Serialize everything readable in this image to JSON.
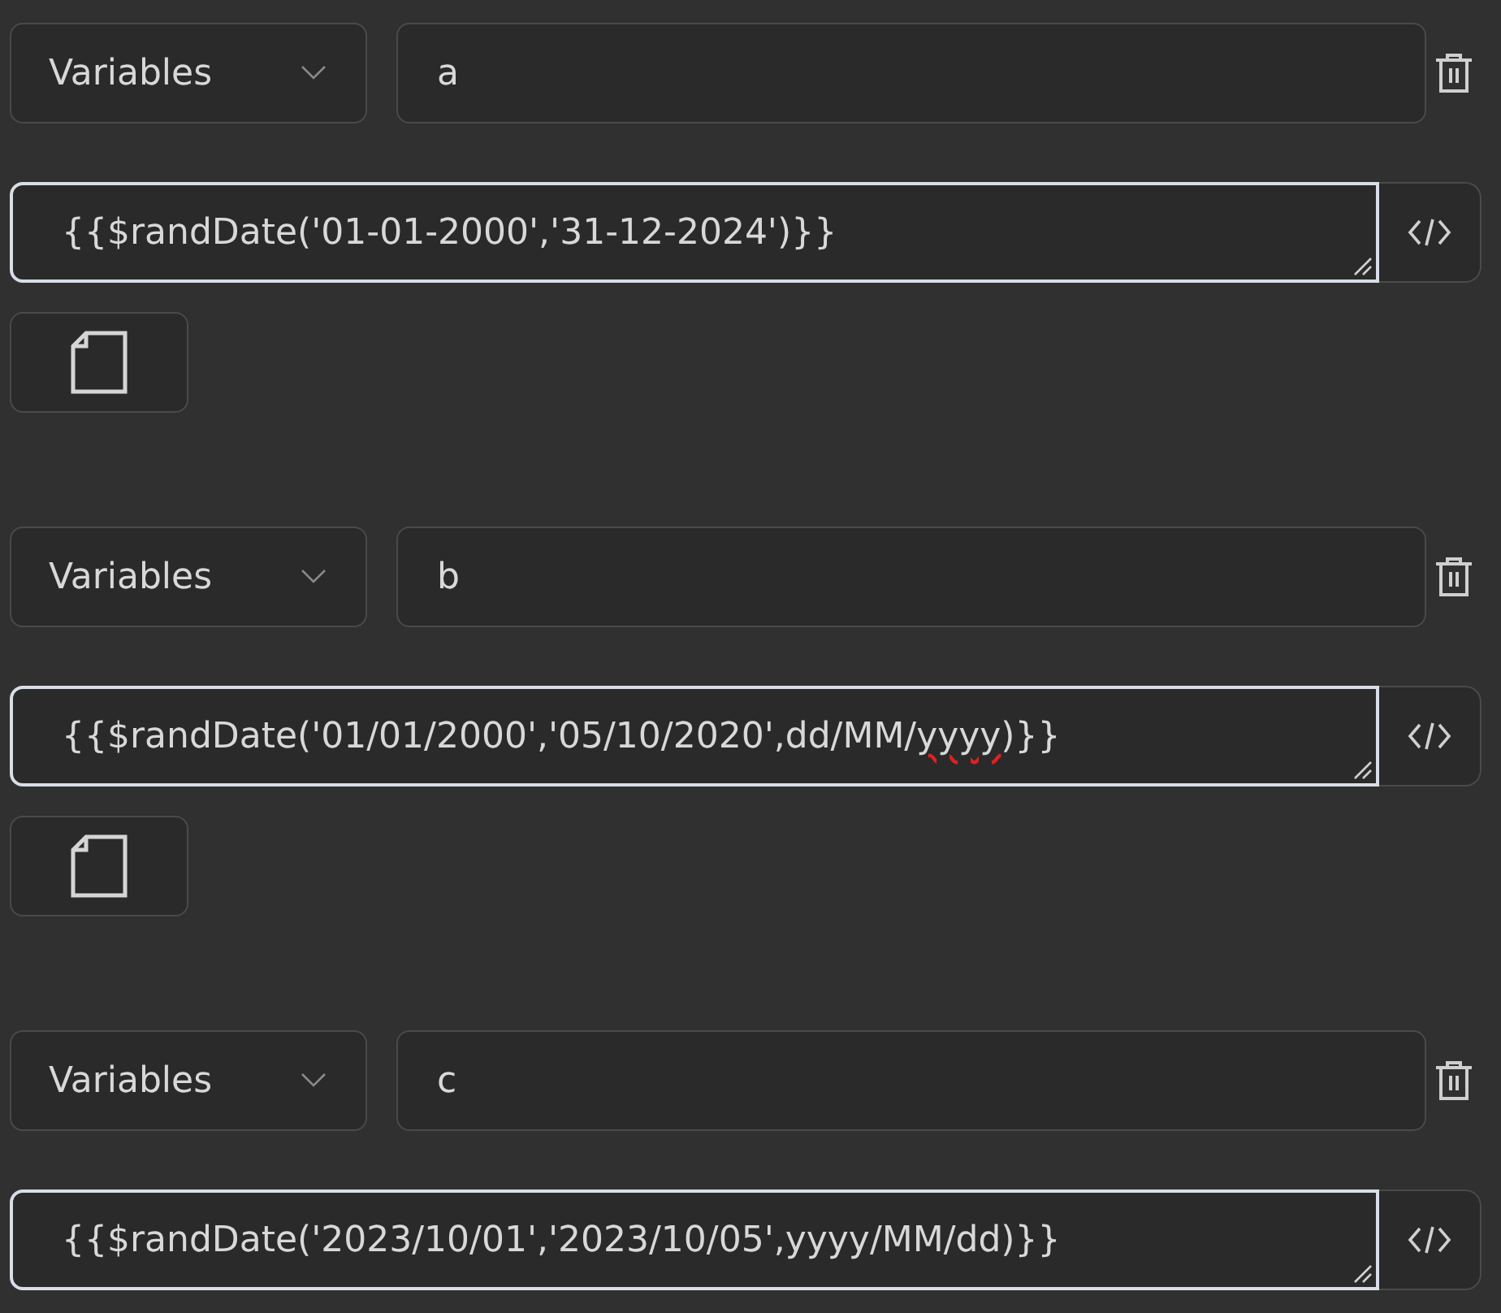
{
  "variables": [
    {
      "type": "Variables",
      "name": "a",
      "value": [
        {
          "text": "{{$randDate('01-01-2000','31-12-2024')}}",
          "misspelled": false
        }
      ],
      "file_button": true
    },
    {
      "type": "Variables",
      "name": "b",
      "value": [
        {
          "text": "{{$randDate('01/01/2000','05/10/2020',dd/MM/",
          "misspelled": false
        },
        {
          "text": "yyyy",
          "misspelled": true
        },
        {
          "text": ")}}",
          "misspelled": false
        }
      ],
      "file_button": true
    },
    {
      "type": "Variables",
      "name": "c",
      "value": [
        {
          "text": "{{$randDate('2023/10/01','2023/10/05',yyyy/MM/dd)}}",
          "misspelled": false
        }
      ],
      "file_button": false
    }
  ]
}
